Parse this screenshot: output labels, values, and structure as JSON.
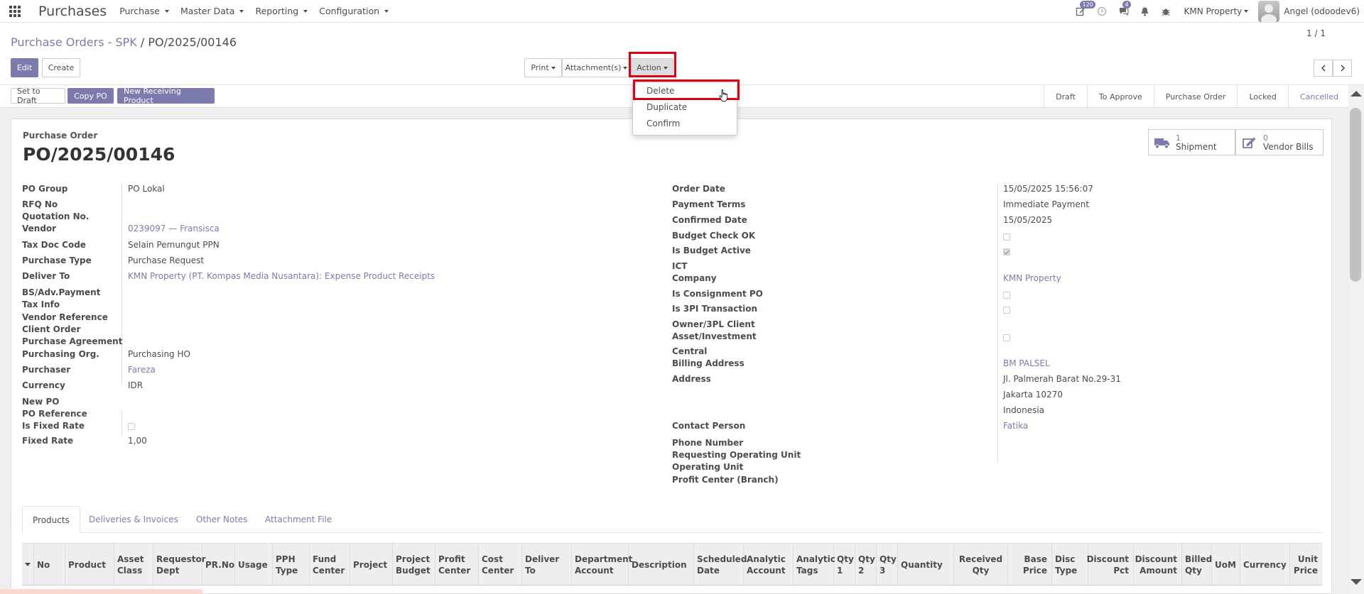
{
  "navbar": {
    "brand": "Purchases",
    "menu": [
      {
        "label": "Purchase"
      },
      {
        "label": "Master Data"
      },
      {
        "label": "Reporting"
      },
      {
        "label": "Configuration"
      }
    ],
    "activity_badge": "120",
    "messages_badge": "4",
    "company": "KMN Property",
    "user": "Angel (odoodev6)"
  },
  "control": {
    "breadcrumb_parent": "Purchase Orders - SPK",
    "breadcrumb_sep": "/",
    "breadcrumb_current": "PO/2025/00146",
    "edit_label": "Edit",
    "create_label": "Create",
    "print_label": "Print",
    "attachment_label": "Attachment(s)",
    "action_label": "Action",
    "pager": "1 / 1"
  },
  "action_menu": {
    "items": [
      {
        "label": "Delete"
      },
      {
        "label": "Duplicate"
      },
      {
        "label": "Confirm"
      }
    ]
  },
  "status_buttons": {
    "set_to_draft": "Set to Draft",
    "copy_po": "Copy PO",
    "new_receiving": "New Receiving Product"
  },
  "stages": [
    {
      "label": "Draft"
    },
    {
      "label": "To Approve"
    },
    {
      "label": "Purchase Order"
    },
    {
      "label": "Locked"
    },
    {
      "label": "Cancelled"
    }
  ],
  "sheet": {
    "type_label": "Purchase Order",
    "title": "PO/2025/00146",
    "shipment_count": "1",
    "shipment_label": "Shipment",
    "bills_count": "0",
    "bills_label": "Vendor Bills"
  },
  "left_fields": {
    "po_group_label": "PO Group",
    "po_group": "PO Lokal",
    "rfq_no_label": "RFQ No",
    "quotation_no_label": "Quotation No.",
    "vendor_label": "Vendor",
    "vendor": "0239097 — Fransisca",
    "tax_doc_label": "Tax Doc Code",
    "tax_doc": "Selain Pemungut PPN",
    "purchase_type_label": "Purchase Type",
    "purchase_type": "Purchase Request",
    "deliver_to_label": "Deliver To",
    "deliver_to": "KMN Property (PT. Kompas Media Nusantara): Expense Product Receipts",
    "bs_adv_label": "BS/Adv.Payment",
    "tax_info_label": "Tax Info",
    "vendor_ref_label": "Vendor Reference",
    "client_order_label": "Client Order",
    "purchase_agreement_label": "Purchase Agreement",
    "purchasing_org_label": "Purchasing Org.",
    "purchasing_org": "Purchasing HO",
    "purchaser_label": "Purchaser",
    "purchaser": "Fareza",
    "currency_label": "Currency",
    "currency": "IDR",
    "new_po_label": "New PO",
    "po_reference_label": "PO Reference",
    "is_fixed_rate_label": "Is Fixed Rate",
    "fixed_rate_label": "Fixed Rate",
    "fixed_rate": "1,00"
  },
  "right_fields": {
    "order_date_label": "Order Date",
    "order_date": "15/05/2025 15:56:07",
    "payment_terms_label": "Payment Terms",
    "payment_terms": "Immediate Payment",
    "confirmed_date_label": "Confirmed Date",
    "confirmed_date": "15/05/2025",
    "budget_check_label": "Budget Check OK",
    "is_budget_active_label": "Is Budget Active",
    "ict_label": "ICT",
    "company_label": "Company",
    "company": "KMN Property",
    "is_consignment_label": "Is Consignment PO",
    "is_3pl_label": "Is 3PI Transaction",
    "owner_3pl_label": "Owner/3PL Client",
    "asset_investment_label": "Asset/Investment",
    "central_label": "Central",
    "billing_address_label": "Billing Address",
    "billing_address": "BM PALSEL",
    "address_label": "Address",
    "address_line1": "Jl. Palmerah Barat No.29-31",
    "address_line2": "Jakarta  10270",
    "address_line3": "Indonesia",
    "contact_person_label": "Contact Person",
    "contact_person": "Fatika",
    "phone_label": "Phone Number",
    "req_op_unit_label": "Requesting Operating Unit",
    "op_unit_label": "Operating Unit",
    "profit_center_label": "Profit Center (Branch)"
  },
  "tabs": [
    {
      "label": "Products"
    },
    {
      "label": "Deliveries & Invoices"
    },
    {
      "label": "Other Notes"
    },
    {
      "label": "Attachment File"
    }
  ],
  "table_headers": [
    "No",
    "Product",
    "Asset Class",
    "Requestor Dept",
    "PR.No",
    "Usage",
    "PPH Type",
    "Fund Center",
    "Project",
    "Project Budget",
    "Profit Center",
    "Cost Center",
    "Deliver To",
    "Department Account",
    "Description",
    "Scheduled Date",
    "Analytic Account",
    "Analytic Tags",
    "Qty 1",
    "Qty 2",
    "Qty 3",
    "Quantity",
    "Received Qty",
    "Base Price",
    "Disc Type",
    "Discount Pct",
    "Discount Amount",
    "Billed Qty",
    "UoM",
    "Currency",
    "Unit Price"
  ],
  "colors": {
    "brand": "#7c7bad",
    "highlight": "#e0000f"
  }
}
